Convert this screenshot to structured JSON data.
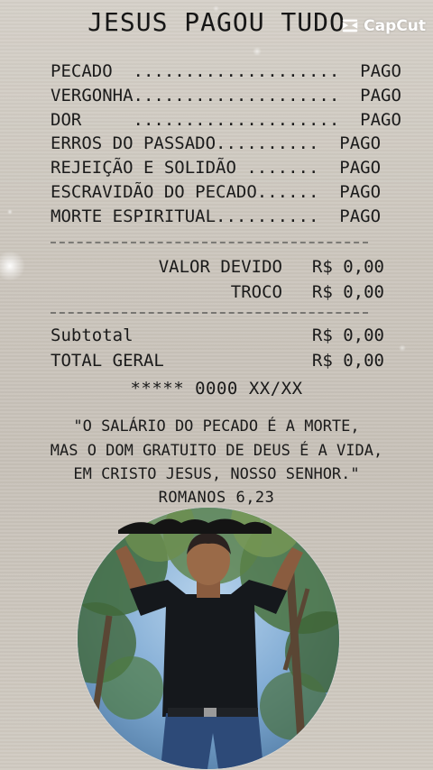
{
  "receipt": {
    "title": "JESUS PAGOU TUDO",
    "items": [
      {
        "text": "PECADO  ....................  PAGO"
      },
      {
        "text": "VERGONHA....................  PAGO"
      },
      {
        "text": "DOR     ....................  PAGO"
      },
      {
        "text": "ERROS DO PASSADO..........  PAGO"
      },
      {
        "text": "REJEIÇÃO E SOLIDÃO .......  PAGO"
      },
      {
        "text": "ESCRAVIDÃO DO PECADO......  PAGO"
      },
      {
        "text": "MORTE ESPIRITUAL..........  PAGO"
      }
    ],
    "valor_devido_label": "VALOR DEVIDO",
    "valor_devido_value": "R$ 0,00",
    "troco_label": "TROCO",
    "troco_value": "R$ 0,00",
    "subtotal_label": "Subtotal",
    "subtotal_value": "R$ 0,00",
    "total_geral_label": "TOTAL GERAL",
    "total_geral_value": "R$ 0,00",
    "auth_code": "***** 0000 XX/XX",
    "verse_lines": [
      "\"O SALÁRIO DO PECADO É A MORTE,",
      "MAS O DOM GRATUITO DE DEUS É A VIDA,",
      "EM CRISTO JESUS, NOSSO SENHOR.\""
    ],
    "reference": "ROMANOS 6,23"
  },
  "watermark": {
    "brand": "CapCut",
    "icon": "capcut-logo-icon"
  },
  "photo": {
    "description_icon": "person-photo"
  },
  "colors": {
    "background": "#cac4bb",
    "ink": "#1a1a1a",
    "sky": "#6f9dc9",
    "foliage": "#3f6a3a"
  }
}
